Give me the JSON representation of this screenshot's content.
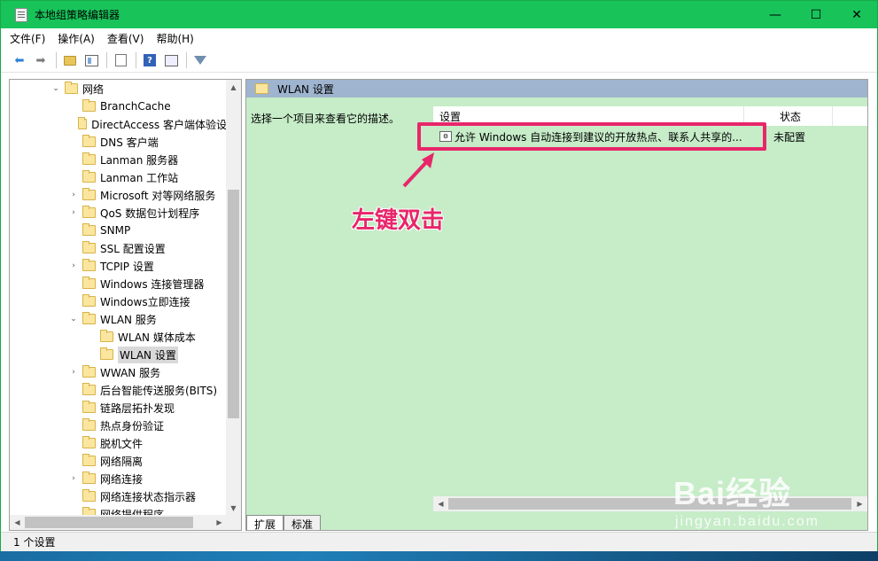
{
  "window": {
    "title": "本地组策略编辑器",
    "minimize": "—",
    "maximize": "☐",
    "close": "✕"
  },
  "menu": [
    "文件(F)",
    "操作(A)",
    "查看(V)",
    "帮助(H)"
  ],
  "tree": {
    "items": [
      {
        "label": "网络",
        "arrow": "⌄",
        "level": 0
      },
      {
        "label": "BranchCache",
        "arrow": "",
        "level": 1
      },
      {
        "label": "DirectAccess 客户端体验设",
        "arrow": "",
        "level": 1
      },
      {
        "label": "DNS 客户端",
        "arrow": "",
        "level": 1
      },
      {
        "label": "Lanman 服务器",
        "arrow": "",
        "level": 1
      },
      {
        "label": "Lanman 工作站",
        "arrow": "",
        "level": 1
      },
      {
        "label": "Microsoft 对等网络服务",
        "arrow": "›",
        "level": 1
      },
      {
        "label": "QoS 数据包计划程序",
        "arrow": "›",
        "level": 1
      },
      {
        "label": "SNMP",
        "arrow": "",
        "level": 1
      },
      {
        "label": "SSL 配置设置",
        "arrow": "",
        "level": 1
      },
      {
        "label": "TCPIP 设置",
        "arrow": "›",
        "level": 1
      },
      {
        "label": "Windows 连接管理器",
        "arrow": "",
        "level": 1
      },
      {
        "label": "Windows立即连接",
        "arrow": "",
        "level": 1
      },
      {
        "label": "WLAN 服务",
        "arrow": "⌄",
        "level": 1
      },
      {
        "label": "WLAN 媒体成本",
        "arrow": "",
        "level": 2
      },
      {
        "label": "WLAN 设置",
        "arrow": "",
        "level": 2,
        "selected": true
      },
      {
        "label": "WWAN 服务",
        "arrow": "›",
        "level": 1
      },
      {
        "label": "后台智能传送服务(BITS)",
        "arrow": "",
        "level": 1
      },
      {
        "label": "链路层拓扑发现",
        "arrow": "",
        "level": 1
      },
      {
        "label": "热点身份验证",
        "arrow": "",
        "level": 1
      },
      {
        "label": "脱机文件",
        "arrow": "",
        "level": 1
      },
      {
        "label": "网络隔离",
        "arrow": "",
        "level": 1
      },
      {
        "label": "网络连接",
        "arrow": "›",
        "level": 1
      },
      {
        "label": "网络连接状态指示器",
        "arrow": "",
        "level": 1
      },
      {
        "label": "网络提供程序",
        "arrow": "",
        "level": 1
      }
    ]
  },
  "content": {
    "header": "WLAN 设置",
    "description": "选择一个项目来查看它的描述。",
    "columns": {
      "setting": "设置",
      "status": "状态"
    },
    "rows": [
      {
        "setting": "允许 Windows 自动连接到建议的开放热点、联系人共享的...",
        "status": "未配置"
      }
    ]
  },
  "tabs": [
    "扩展",
    "标准"
  ],
  "status_bar": "1 个设置",
  "annotation": "左键双击",
  "watermark": {
    "main": "Bai经验",
    "sub": "jingyan.baidu.com"
  },
  "colors": {
    "titlebar": "#18c35a",
    "content_bg": "#c6ecc8",
    "highlight": "#e8266a"
  }
}
